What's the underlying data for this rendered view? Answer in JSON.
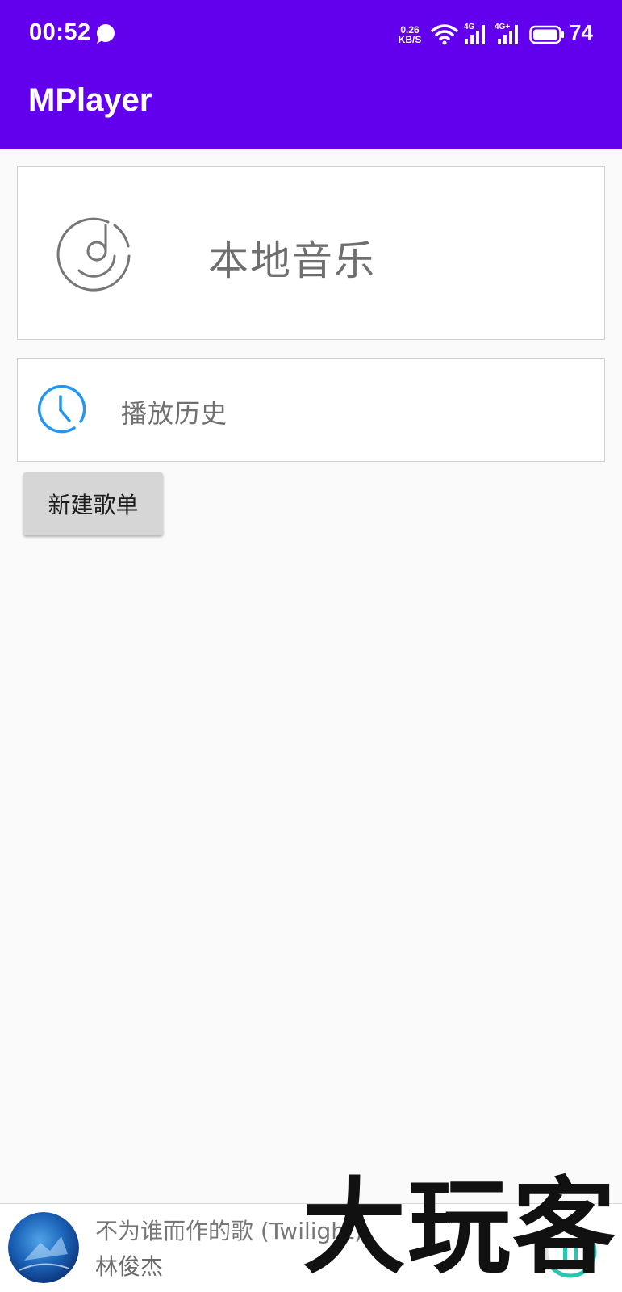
{
  "status_bar": {
    "time": "00:52",
    "net_speed_value": "0.26",
    "net_speed_unit": "KB/S",
    "signal1_label": "4G",
    "signal2_label": "4G+",
    "battery_level": "74"
  },
  "app_bar": {
    "title": "MPlayer"
  },
  "menu": {
    "local_music": {
      "label": "本地音乐",
      "icon": "music-disc-icon"
    },
    "play_history": {
      "label": "播放历史",
      "icon": "clock-icon",
      "icon_color": "#2196f3"
    }
  },
  "new_playlist_button": {
    "label": "新建歌单"
  },
  "mini_player": {
    "song_title": "不为谁而作的歌 (Twilight)",
    "artist": "林俊杰",
    "accent_color": "#26c6b0"
  },
  "watermark": {
    "text": "大玩客"
  },
  "colors": {
    "primary": "#6200ee",
    "background": "#fafafa"
  }
}
